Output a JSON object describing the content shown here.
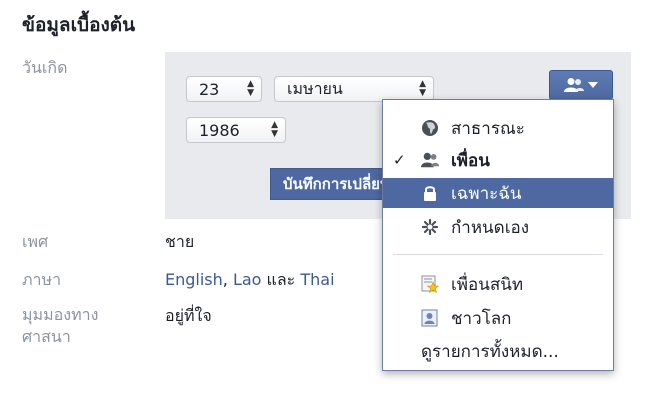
{
  "title": "ข้อมูลเบื้องต้น",
  "birthday": {
    "label": "วันเกิด",
    "day": "23",
    "month": "เมษายน",
    "year": "1986",
    "save_label": "บันทึกการเปลี่ยนแปลง"
  },
  "gender": {
    "label": "เพศ",
    "value": "ชาย"
  },
  "languages": {
    "label": "ภาษา",
    "items": [
      "English",
      "Lao",
      "Thai"
    ],
    "sep1": ", ",
    "and": " และ "
  },
  "religion": {
    "label_line1": "มุมมองทาง",
    "label_line2": "ศาสนา",
    "value": "อยู่ที่ใจ"
  },
  "privacy_menu": {
    "button_icon": "friends-icon",
    "items": [
      {
        "label": "สาธารณะ",
        "icon": "globe-icon"
      },
      {
        "label": "เพื่อน",
        "icon": "friends-icon",
        "checked": true
      },
      {
        "label": "เฉพาะฉัน",
        "icon": "lock-icon",
        "highlighted": true
      },
      {
        "label": "กำหนดเอง",
        "icon": "gear-icon"
      },
      {
        "label": "เพื่อนสนิท",
        "icon": "star-list-icon"
      },
      {
        "label": "ชาวโลก",
        "icon": "person-list-icon"
      },
      {
        "label": "ดูรายการทั้งหมด..."
      }
    ],
    "check_mark": "✓",
    "accent": "#4e69a2"
  }
}
